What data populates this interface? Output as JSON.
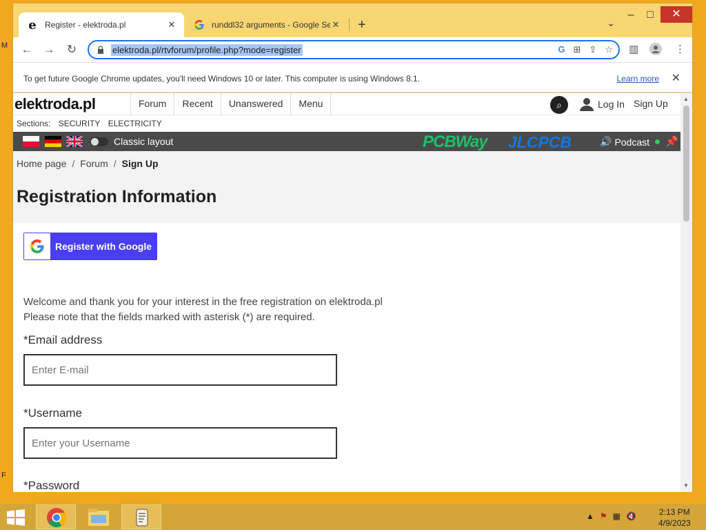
{
  "desktop": {
    "left_label_top": "M",
    "left_label_bottom": "F"
  },
  "tabs": [
    {
      "title": "Register - elektroda.pl",
      "icon": "e"
    },
    {
      "title": "runddl32 arguments - Google Se",
      "icon": "G"
    }
  ],
  "toolbar": {
    "url": "elektroda.pl/rtvforum/profile.php?mode=register"
  },
  "infobar": {
    "text": "To get future Google Chrome updates, you'll need Windows 10 or later. This computer is using Windows 8.1.",
    "learn_more": "Learn more"
  },
  "site": {
    "logo": "elektroda.pl",
    "nav": [
      "Forum",
      "Recent",
      "Unanswered",
      "Menu"
    ],
    "login": "Log In",
    "signup": "Sign Up",
    "sections_label": "Sections:",
    "sections": [
      "SECURITY",
      "ELECTRICITY"
    ],
    "classic_layout": "Classic layout",
    "sponsor1": "PCBWay",
    "sponsor2": "JLCPCB",
    "podcast": "Podcast"
  },
  "breadcrumb": {
    "home": "Home page",
    "forum": "Forum",
    "current": "Sign Up"
  },
  "page_title": "Registration Information",
  "google_button": "Register with Google",
  "welcome": {
    "line1": "Welcome and thank you for your interest in the free registration on elektroda.pl",
    "line2": "Please note that the fields marked with asterisk (*) are required."
  },
  "fields": {
    "email_label": "*Email address",
    "email_placeholder": "Enter E-mail",
    "username_label": "*Username",
    "username_placeholder": "Enter your Username",
    "password_label": "*Password"
  },
  "taskbar": {
    "time": "2:13 PM",
    "date": "4/9/2023"
  }
}
